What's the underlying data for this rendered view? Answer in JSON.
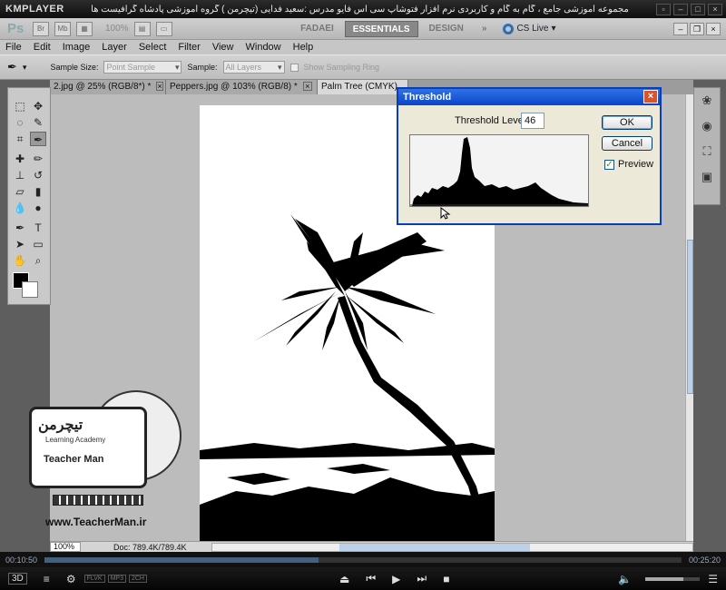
{
  "kmplayer": {
    "logo": "KMPLAYER",
    "caption": "مجموعه آموزشی جامع ، گام به گام و کاربردی نرم افزار فتوشاپ سی اس فایو  مدرس :سعید فدایی (تیچرمن ) گروه آموزشی پادشاه گرافیست ها",
    "time_elapsed": "00:10:50",
    "time_total": "00:25:20",
    "tags": [
      "FLVK",
      "MP3",
      "2CH"
    ],
    "progress": 0.43,
    "volume": 0.7
  },
  "ps_appbar": {
    "logo": "Ps",
    "zoom": "100%",
    "workspaces": [
      "FADAEI",
      "ESSENTIALS",
      "DESIGN"
    ],
    "active_workspace": "ESSENTIALS",
    "more": "»",
    "cs_live": "CS Live"
  },
  "menu": [
    "File",
    "Edit",
    "Image",
    "Layer",
    "Select",
    "Filter",
    "View",
    "Window",
    "Help"
  ],
  "options": {
    "sample_size_label": "Sample Size:",
    "sample_size_value": "Point Sample",
    "sample_label": "Sample:",
    "sample_value": "All Layers",
    "show_ring": "Show Sampling Ring"
  },
  "doc_tabs": [
    {
      "label": "2.jpg @ 25% (RGB/8*) *"
    },
    {
      "label": "Peppers.jpg @ 103% (RGB/8) *"
    },
    {
      "label": "Palm Tree (CMYK)."
    }
  ],
  "status": {
    "zoom": "100%",
    "doc_info": "Doc: 789.4K/789.4K"
  },
  "threshold": {
    "title": "Threshold",
    "level_label": "Threshold Level:",
    "level_value": "46",
    "ok": "OK",
    "cancel": "Cancel",
    "preview": "Preview",
    "preview_checked": true
  },
  "watermark": {
    "logo_text": "تیچرمن",
    "sub": "Learning Academy",
    "name": "Teacher Man",
    "url": "www.TeacherMan.ir"
  }
}
